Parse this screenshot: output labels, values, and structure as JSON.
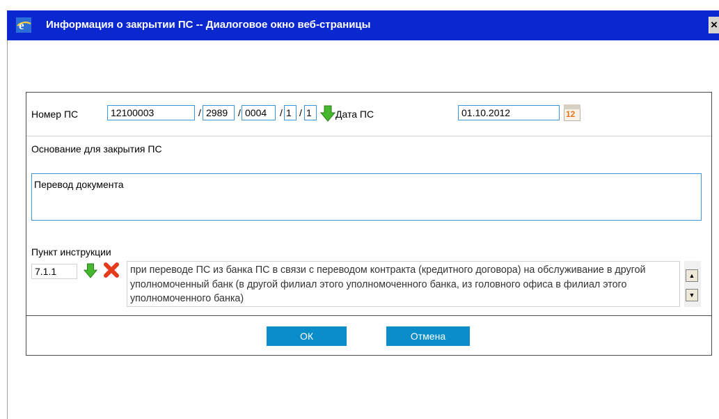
{
  "window": {
    "title": "Информация о закрытии ПС -- Диалоговое окно веб-страницы",
    "close_glyph": "×"
  },
  "form": {
    "number_label": "Номер ПС",
    "number_parts": [
      "12100003",
      "2989",
      "0004",
      "1",
      "1"
    ],
    "separator": "/",
    "date_label": "Дата ПС",
    "date_value": "01.10.2012",
    "calendar_day": "12",
    "reason_label": "Основание для закрытия ПС",
    "reason_value": "Перевод документа",
    "instruction_label": "Пункт инструкции",
    "instruction_code": "7.1.1",
    "instruction_text": "при переводе ПС из банка ПС в связи с переводом контракта (кредитного договора) на обслуживание в другой уполномоченный банк (в другой филиал этого уполномоченного банка, из головного офиса в филиал этого уполномоченного банка)"
  },
  "buttons": {
    "ok": "ОК",
    "cancel": "Отмена"
  },
  "colors": {
    "titlebar": "#0b28d0",
    "input_border": "#3d95d8",
    "button_bg": "#0a8dc9",
    "arrow_green": "#46b82d",
    "delete_red": "#e23b1e"
  },
  "icons": {
    "titlebar": "ie-icon",
    "number_arrow": "green-down-arrow-icon",
    "calendar": "calendar-icon",
    "instruction_arrow": "green-down-arrow-icon",
    "delete": "red-x-icon"
  }
}
